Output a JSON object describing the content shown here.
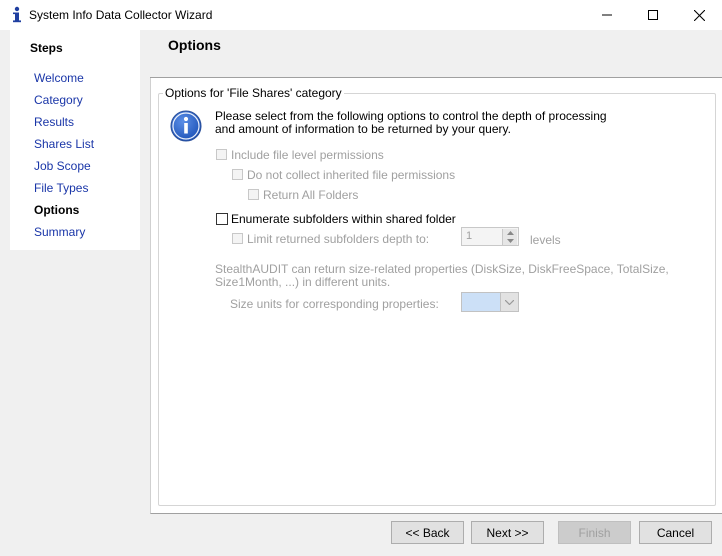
{
  "window": {
    "title": "System Info Data Collector Wizard",
    "app_icon": "info-letter-icon",
    "controls": [
      "minimize-icon",
      "maximize-icon",
      "close-icon"
    ]
  },
  "sidebar": {
    "heading": "Steps",
    "items": [
      {
        "label": "Welcome",
        "state": "link"
      },
      {
        "label": "Category",
        "state": "link"
      },
      {
        "label": "Results",
        "state": "link"
      },
      {
        "label": "Shares List",
        "state": "link"
      },
      {
        "label": "Job Scope",
        "state": "link"
      },
      {
        "label": "File Types",
        "state": "link"
      },
      {
        "label": "Options",
        "state": "current"
      },
      {
        "label": "Summary",
        "state": "link"
      }
    ]
  },
  "page": {
    "title": "Options"
  },
  "group": {
    "legend": "Options for 'File Shares' category",
    "info_icon": "info-circle-icon",
    "description_line1": "Please select from the following options to control the depth of processing",
    "description_line2": "and amount of information to be returned by your query.",
    "options": {
      "include_file_level_permissions": {
        "label": "Include file level permissions",
        "checked": false,
        "enabled": false
      },
      "no_inherited_permissions": {
        "label": "Do not collect inherited file permissions",
        "checked": false,
        "enabled": false
      },
      "return_all_folders": {
        "label": "Return All Folders",
        "checked": false,
        "enabled": false
      },
      "enumerate_subfolders": {
        "label": "Enumerate subfolders within shared folder",
        "checked": false,
        "enabled": true
      },
      "limit_depth": {
        "label": "Limit returned subfolders depth to:",
        "checked": false,
        "enabled": false
      }
    },
    "depth_value": "1",
    "depth_suffix": "levels",
    "size_note_line1": "StealthAUDIT can return size-related properties (DiskSize, DiskFreeSpace, TotalSize,",
    "size_note_line2": "Size1Month, ...) in different units.",
    "size_units_label": "Size units for corresponding properties:",
    "size_units_value": ""
  },
  "buttons": {
    "back": "<< Back",
    "next": "Next >>",
    "finish": "Finish",
    "cancel": "Cancel"
  },
  "colors": {
    "link": "#1a36a8",
    "disabled_text": "#a0a0a0",
    "panel_bg": "#ffffff",
    "window_bg": "#f0f0f0"
  }
}
